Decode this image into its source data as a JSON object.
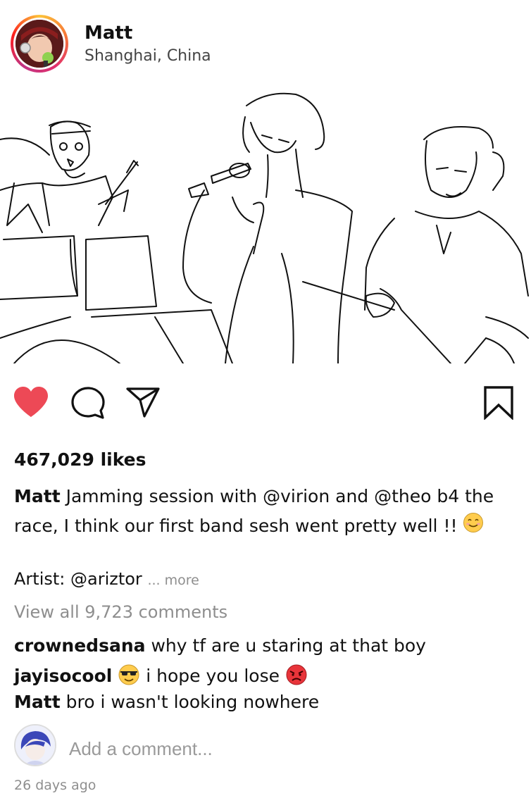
{
  "post": {
    "username": "Matt",
    "location": "Shanghai, China",
    "likes": "467,029 likes",
    "caption_user": "Matt",
    "caption_text": "Jamming session with @virion and @theo b4 the race, I think our first band sesh went pretty well !!",
    "caption_emoji": "smiling-face-emoji",
    "artist_text": "Artist: @ariztor",
    "more_label": "... more",
    "view_all": "View all 9,723 comments",
    "timestamp": "26 days ago"
  },
  "actions": {
    "like_icon": "heart-icon",
    "like_color": "#ed4956",
    "comment_icon": "speech-bubble-icon",
    "share_icon": "paper-plane-icon",
    "save_icon": "bookmark-icon"
  },
  "comments": [
    {
      "user": "crownedsana",
      "text": "why tf are u staring at that boy"
    },
    {
      "user": "jayisocool",
      "emoji_before": "sunglasses-face-emoji",
      "text": "i hope you lose",
      "emoji_after": "angry-face-emoji"
    },
    {
      "user": "Matt",
      "text": "bro i wasn't looking nowhere"
    }
  ],
  "add_comment": {
    "placeholder": "Add a comment..."
  }
}
